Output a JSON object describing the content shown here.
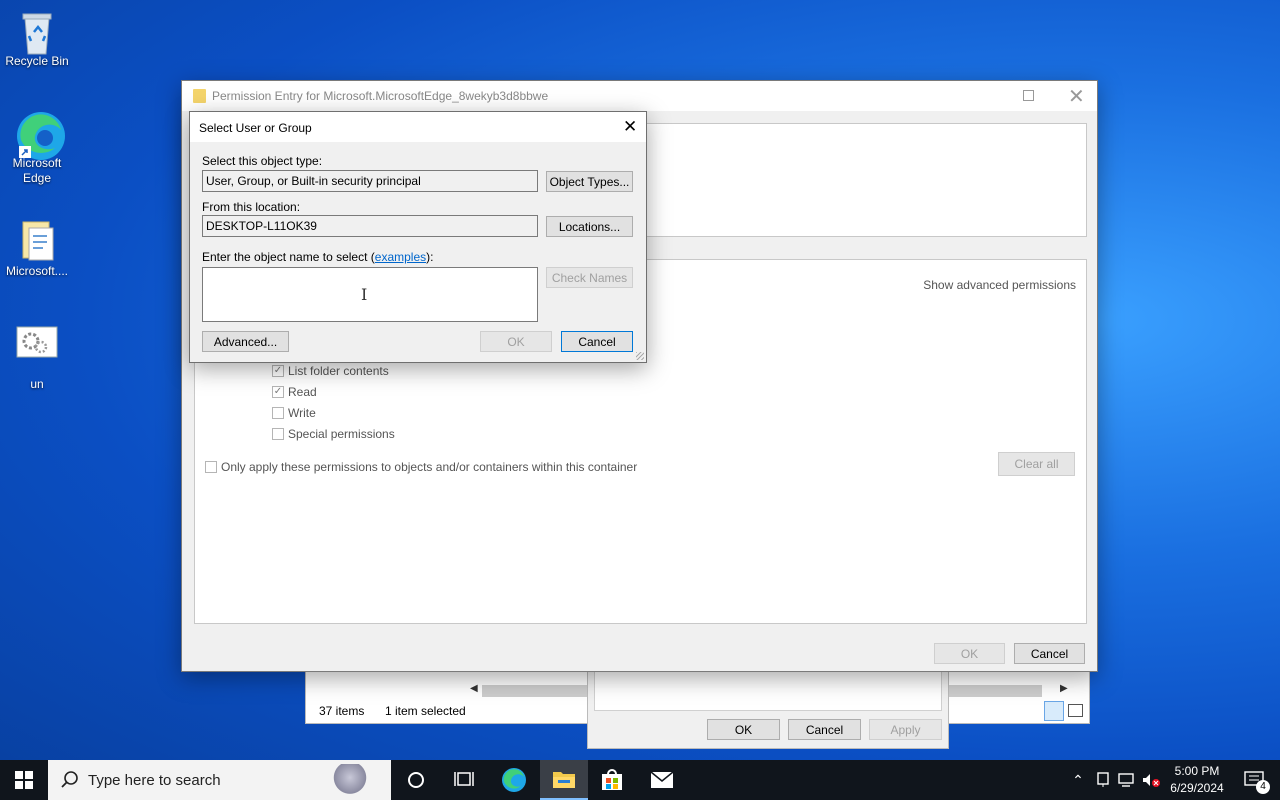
{
  "desktop": {
    "icons": [
      {
        "label": "Recycle Bin"
      },
      {
        "label": "Microsoft Edge"
      },
      {
        "label": "Microsoft...."
      },
      {
        "label": "un"
      }
    ]
  },
  "explorer_back": {
    "status_items": "37 items",
    "status_selected": "1 item selected"
  },
  "properties_back": {
    "ok": "OK",
    "cancel": "Cancel",
    "apply": "Apply"
  },
  "perm_entry": {
    "title": "Permission Entry for Microsoft.MicrosoftEdge_8wekyb3d8bbwe",
    "show_advanced": "Show advanced permissions",
    "permissions": [
      {
        "label": "List folder contents",
        "checked": true
      },
      {
        "label": "Read",
        "checked": true
      },
      {
        "label": "Write",
        "checked": false
      },
      {
        "label": "Special permissions",
        "checked": false
      }
    ],
    "only_apply": "Only apply these permissions to objects and/or containers within this container",
    "clear_all": "Clear all",
    "ok": "OK",
    "cancel": "Cancel"
  },
  "select_dialog": {
    "title": "Select User or Group",
    "object_type_label": "Select this object type:",
    "object_type_value": "User, Group, or Built-in security principal",
    "object_types_button": "Object Types...",
    "location_label": "From this location:",
    "location_value": "DESKTOP-L11OK39",
    "locations_button": "Locations...",
    "enter_label_prefix": "Enter the object name to select (",
    "examples_link": "examples",
    "enter_label_suffix": "):",
    "object_name_value": "",
    "check_names_button": "Check Names",
    "advanced_button": "Advanced...",
    "ok": "OK",
    "cancel": "Cancel"
  },
  "taskbar": {
    "search_placeholder": "Type here to search",
    "time": "5:00 PM",
    "date": "6/29/2024",
    "notification_count": "4"
  }
}
